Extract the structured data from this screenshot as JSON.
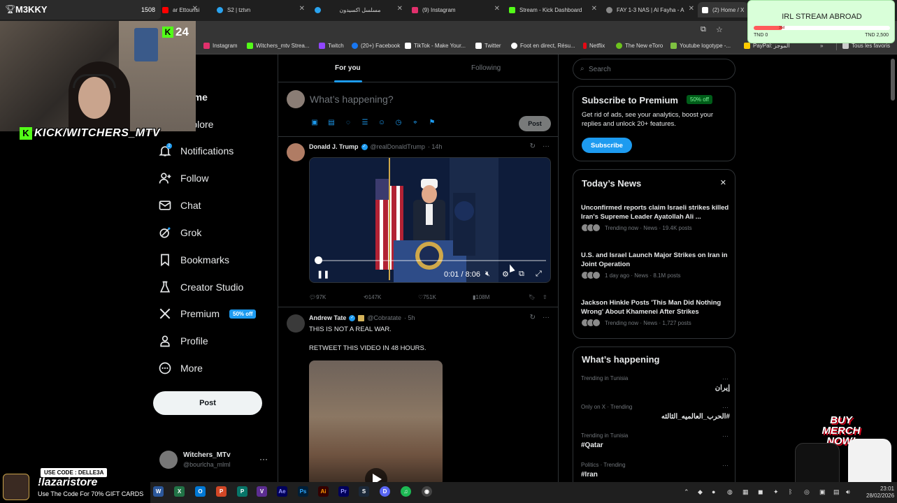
{
  "browser": {
    "tabs": [
      {
        "title": "ar Ettounsi - Y",
        "color": "#ff0000"
      },
      {
        "title": "S2 | tztvn",
        "color": "#2aa3ef"
      },
      {
        "title": "مسلسل اكسيدون",
        "color": "#2aa3ef"
      },
      {
        "title": "(9) Instagram",
        "color": "#e1306c"
      },
      {
        "title": "Stream - Kick Dashboard",
        "color": "#53fc18"
      },
      {
        "title": "FAY 1-3 NAS | Al Fayha - A",
        "color": "#888888"
      },
      {
        "title": "(2) Home / X",
        "color": "#ffffff"
      }
    ],
    "bookmarks": [
      {
        "label": "Instagram",
        "color": "#e1306c"
      },
      {
        "label": "Witchers_mtv Strea...",
        "color": "#53fc18"
      },
      {
        "label": "Twitch",
        "color": "#9146ff"
      },
      {
        "label": "(20+) Facebook",
        "color": "#1877f2"
      },
      {
        "label": "TikTok - Make Your...",
        "color": "#ffffff"
      },
      {
        "label": "Twitter",
        "color": "#ffffff"
      },
      {
        "label": "Foot en direct, Résu...",
        "color": "#ffffff"
      },
      {
        "label": "Netflix",
        "color": "#e50914"
      },
      {
        "label": "The New eToro",
        "color": "#6dc41d"
      },
      {
        "label": "Youtube logotype -...",
        "color": "#7fc241"
      },
      {
        "label": "PayPal: الموجز",
        "color": "#ffcc00"
      },
      {
        "label": "Tous les favoris",
        "color": "#cccccc"
      }
    ]
  },
  "overlay": {
    "streamer_name": "M3KKY",
    "streamer_count": "1508",
    "viewer_count": "24",
    "kick_tag": "KICK/WITCHERS_MTV",
    "goal_title": "IRL STREAM ABROAD",
    "goal_progress": 0.21,
    "goal_pct": "35d",
    "goal_min": "TND 0",
    "goal_max": "TND 2,500",
    "merch_text": "BUY MERCH NOW!",
    "promo_code": "USE CODE : DELLE3A",
    "promo_store": "!lazaristore",
    "promo_offer": "Use The Code For 70% GIFT CARDS"
  },
  "nav": {
    "home": "Home",
    "explore": "Explore",
    "notifications": "Notifications",
    "notif_count": "2",
    "follow": "Follow",
    "chat": "Chat",
    "grok": "Grok",
    "bookmarks": "Bookmarks",
    "creator_studio": "Creator Studio",
    "premium": "Premium",
    "premium_badge": "50% off",
    "profile": "Profile",
    "more": "More",
    "post": "Post",
    "account_name": "Witchers_MTv",
    "account_handle": "@bourlcha_mlml"
  },
  "timeline": {
    "tab_for_you": "For you",
    "tab_following": "Following",
    "composer_placeholder": "What’s happening?",
    "composer_post": "Post",
    "tweets": [
      {
        "name": "Donald J. Trump",
        "handle": "@realDonaldTrump",
        "time": "· 14h",
        "video_time": "0:01 / 8:06",
        "replies": "97K",
        "reposts": "147K",
        "likes": "751K",
        "views": "108M"
      },
      {
        "name": "Andrew Tate",
        "handle": "@Cobratate",
        "time": "· 5h",
        "line1": "THIS IS NOT A REAL WAR.",
        "line2": "RETWEET THIS VIDEO IN 48 HOURS."
      }
    ]
  },
  "sidebar": {
    "search_placeholder": "Search",
    "premium_title": "Subscribe to Premium",
    "premium_badge": "50% off",
    "premium_desc": "Get rid of ads, see your analytics, boost your replies and unlock 20+ features.",
    "subscribe": "Subscribe",
    "news_title": "Today’s News",
    "news": [
      {
        "title": "Unconfirmed reports claim Israeli strikes killed Iran's Supreme Leader Ayatollah Ali ...",
        "meta": "Trending now · News · 19.4K posts"
      },
      {
        "title": "U.S. and Israel Launch Major Strikes on Iran in Joint Operation",
        "meta": "1 day ago · News · 8.1M posts"
      },
      {
        "title": "Jackson Hinkle Posts 'This Man Did Nothing Wrong' About Khamenei After Strikes",
        "meta": "Trending now · News · 1,727 posts"
      }
    ],
    "happening_title": "What’s happening",
    "trends": [
      {
        "context": "Trending in Tunisia",
        "topic": "إيران",
        "rtl": true
      },
      {
        "context": "Only on X · Trending",
        "topic": "#الحرب_العالميه_الثالثه",
        "rtl": true
      },
      {
        "context": "Trending in Tunisia",
        "topic": "#Qatar",
        "rtl": false
      },
      {
        "context": "Politics · Trending",
        "topic": "#Iran",
        "rtl": false
      }
    ]
  },
  "taskbar": {
    "clock_time": "23:01",
    "clock_date": "28/02/2026"
  }
}
